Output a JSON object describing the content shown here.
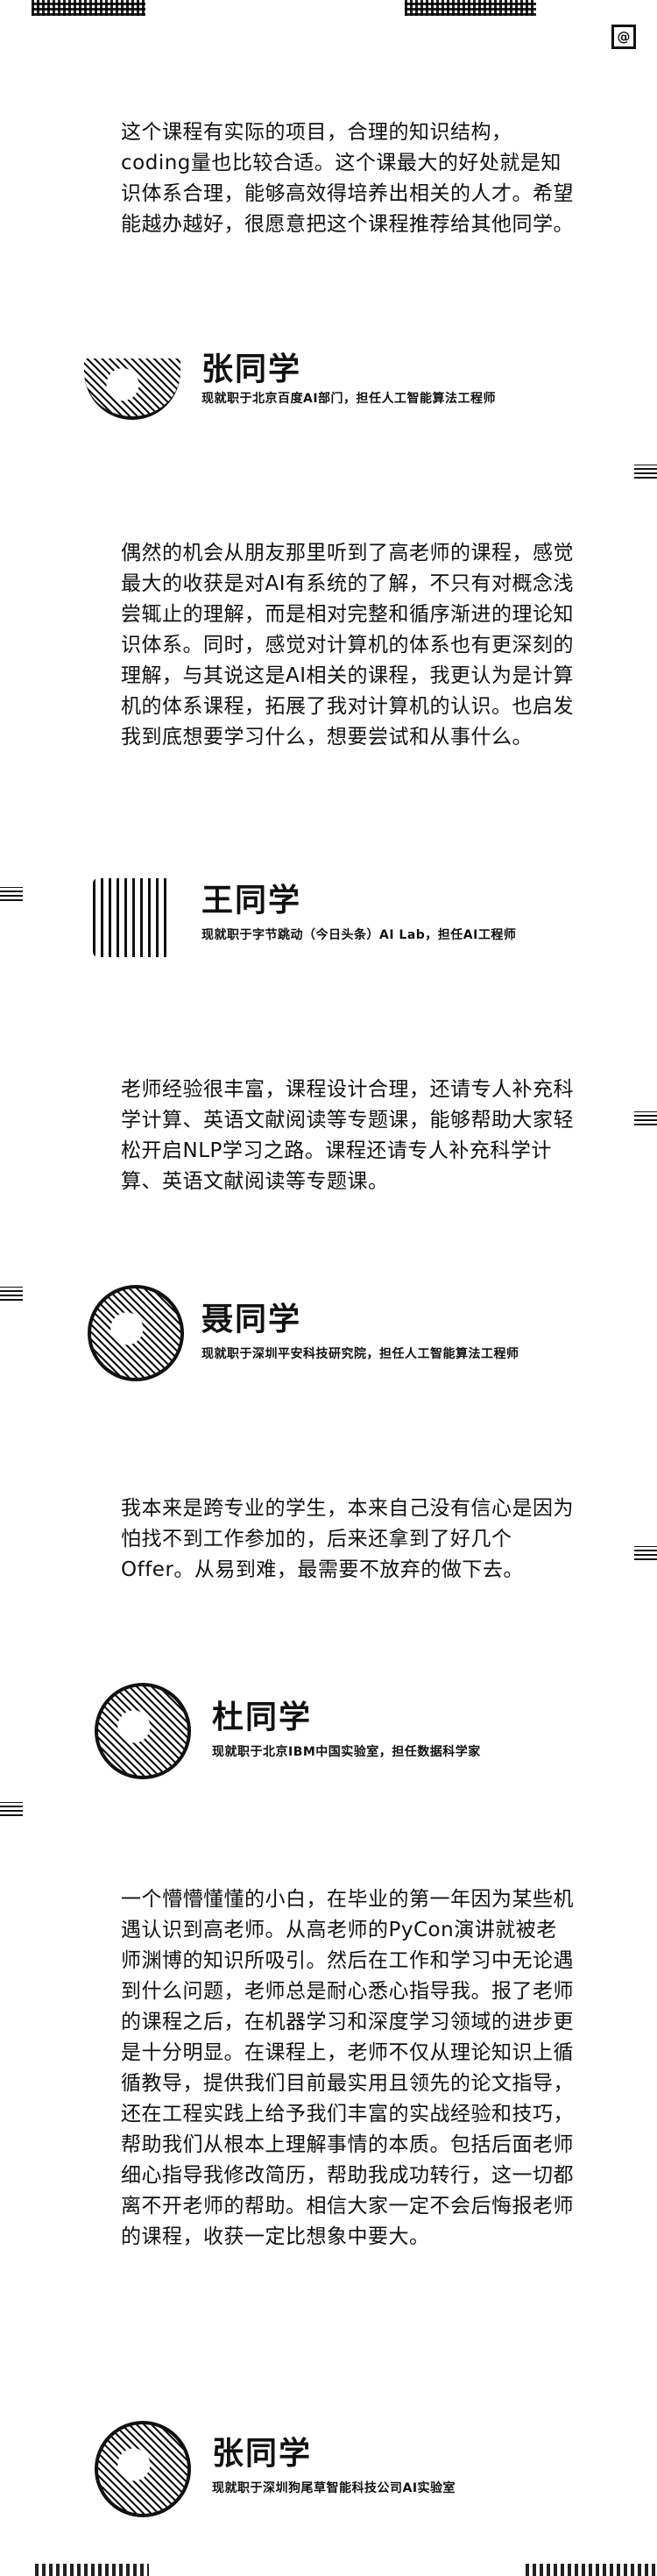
{
  "testimonials": [
    {
      "quote": "这个课程有实际的项目，合理的知识结构，coding量也比较合适。这个课最大的好处就是知识体系合理，能够高效得培养出相关的人才。希望能越办越好，很愿意把这个课程推荐给其他同学。",
      "name": "张同学",
      "role": "现就职于北京百度AI部门，担任人工智能算法工程师"
    },
    {
      "quote": "偶然的机会从朋友那里听到了高老师的课程，感觉最大的收获是对AI有系统的了解，不只有对概念浅尝辄止的理解，而是相对完整和循序渐进的理论知识体系。同时，感觉对计算机的体系也有更深刻的理解，与其说这是AI相关的课程，我更认为是计算机的体系课程，拓展了我对计算机的认识。也启发我到底想要学习什么，想要尝试和从事什么。",
      "name": "王同学",
      "role": "现就职于字节跳动（今日头条）AI Lab，担任AI工程师"
    },
    {
      "quote": "老师经验很丰富，课程设计合理，还请专人补充科学计算、英语文献阅读等专题课，能够帮助大家轻松开启NLP学习之路。课程还请专人补充科学计算、英语文献阅读等专题课。",
      "name": "聂同学",
      "role": "现就职于深圳平安科技研究院，担任人工智能算法工程师"
    },
    {
      "quote": "我本来是跨专业的学生，本来自己没有信心是因为怕找不到工作参加的，后来还拿到了好几个 Offer。从易到难，最需要不放弃的做下去。",
      "name": "杜同学",
      "role": "现就职于北京IBM中国实验室，担任数据科学家"
    },
    {
      "quote": "一个懵懵懂懂的小白，在毕业的第一年因为某些机遇认识到高老师。从高老师的PyCon演讲就被老师渊博的知识所吸引。然后在工作和学习中无论遇到什么问题，老师总是耐心悉心指导我。报了老师的课程之后，在机器学习和深度学习领域的进步更是十分明显。在课程上，老师不仅从理论知识上循循教导，提供我们目前最实用且领先的论文指导，还在工程实践上给予我们丰富的实战经验和技巧，帮助我们从根本上理解事情的本质。包括后面老师细心指导我修改简历，帮助我成功转行，这一切都离不开老师的帮助。相信大家一定不会后悔报老师的课程，收获一定比想象中要大。",
      "name": "张同学",
      "role": "现就职于深圳狗尾草智能科技公司AI实验室"
    }
  ],
  "corner_icon": "@"
}
